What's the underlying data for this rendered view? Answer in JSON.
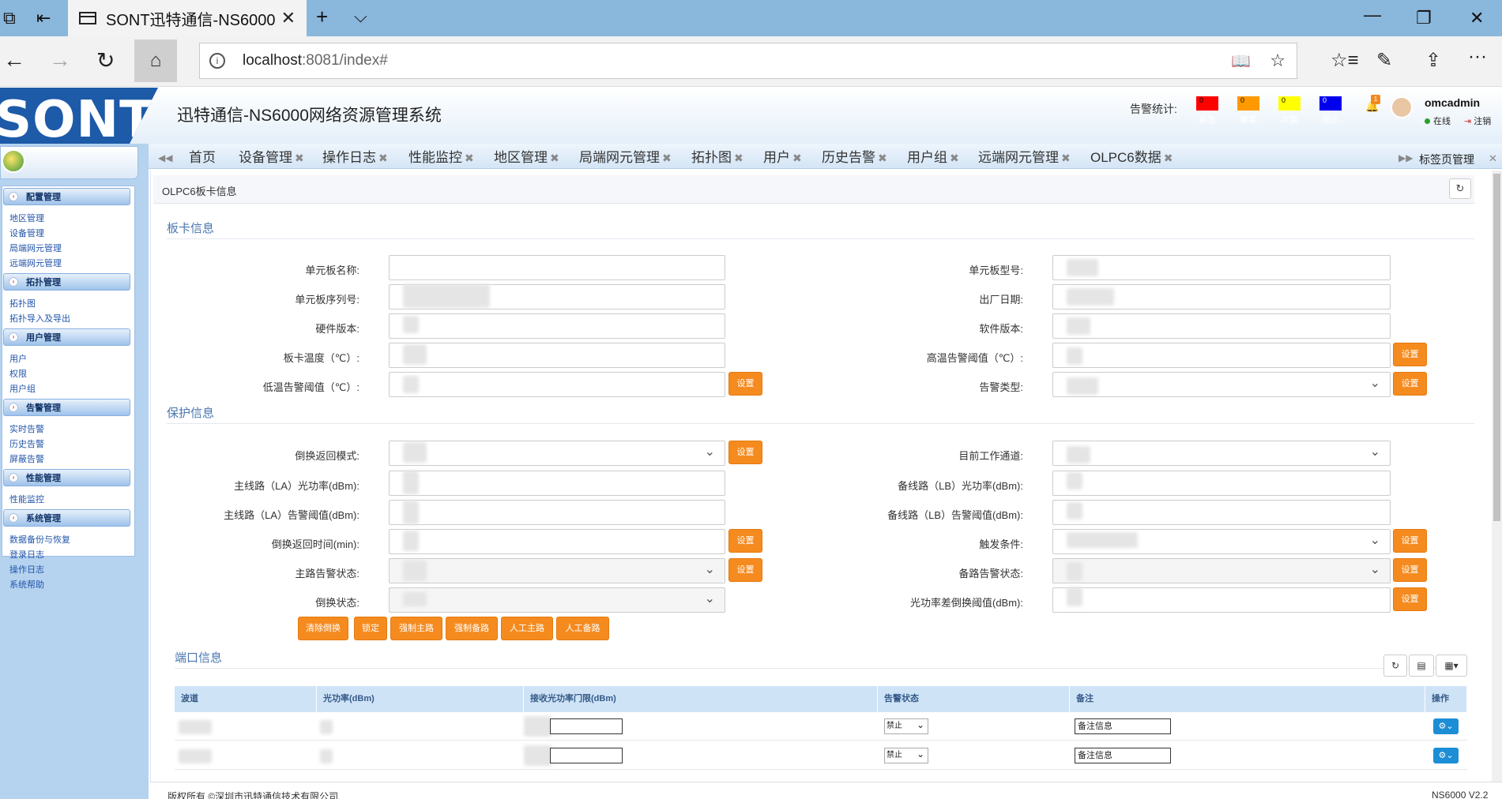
{
  "browser": {
    "tab_title": "SONT迅特通信-NS6000",
    "url_host": "localhost",
    "url_rest": ":8081/index#"
  },
  "app": {
    "logo_text": "SONT",
    "title": "迅特通信-NS6000网络资源管理系统",
    "alarm_stat_label": "告警统计:",
    "alarms": [
      {
        "label": "紧急",
        "count": "0",
        "color": "#ff0000"
      },
      {
        "label": "重要",
        "count": "0",
        "color": "#ff9900"
      },
      {
        "label": "次要",
        "count": "0",
        "color": "#ffff00"
      },
      {
        "label": "提示",
        "count": "0",
        "color": "#0000ee"
      }
    ],
    "notify_count": "1",
    "user": "omcadmin",
    "online": "在线",
    "logout": "注销"
  },
  "sidebar": {
    "groups": [
      {
        "label": "配置管理",
        "items": [
          "地区管理",
          "设备管理",
          "局端网元管理",
          "远端网元管理"
        ]
      },
      {
        "label": "拓扑管理",
        "items": [
          "拓扑图",
          "拓扑导入及导出"
        ]
      },
      {
        "label": "用户管理",
        "items": [
          "用户",
          "权限",
          "用户组"
        ]
      },
      {
        "label": "告警管理",
        "items": [
          "实时告警",
          "历史告警",
          "屏蔽告警"
        ]
      },
      {
        "label": "性能管理",
        "items": [
          "性能监控"
        ]
      },
      {
        "label": "系统管理",
        "items": [
          "数据备份与恢复",
          "登录日志",
          "操作日志",
          "系统帮助"
        ]
      }
    ]
  },
  "tabs": [
    "首页",
    "设备管理",
    "操作日志",
    "性能监控",
    "地区管理",
    "局端网元管理",
    "拓扑图",
    "用户",
    "历史告警",
    "用户组",
    "远端网元管理",
    "OLPC6数据"
  ],
  "tab_manager": "标签页管理",
  "page": {
    "title": "OLPC6板卡信息",
    "board_section": "板卡信息",
    "protect_section": "保护信息",
    "port_section": "端口信息",
    "set_label": "设置",
    "board_fields": {
      "left": [
        "单元板名称:",
        "单元板序列号:",
        "硬件版本:",
        "板卡温度（℃）:",
        "低温告警阈值（℃）:"
      ],
      "right": [
        "单元板型号:",
        "出厂日期:",
        "软件版本:",
        "高温告警阈值（℃）:",
        "告警类型:"
      ]
    },
    "protect_fields": {
      "left": [
        "倒换返回模式:",
        "主线路（LA）光功率(dBm):",
        "主线路（LA）告警阈值(dBm):",
        "倒换返回时间(min):",
        "主路告警状态:",
        "倒换状态:"
      ],
      "right": [
        "目前工作通道:",
        "备线路（LB）光功率(dBm):",
        "备线路（LB）告警阈值(dBm):",
        "触发条件:",
        "备路告警状态:",
        "光功率差倒换阈值(dBm):"
      ]
    },
    "actions": [
      "清除倒换",
      "锁定",
      "强制主路",
      "强制备路",
      "人工主路",
      "人工备路"
    ],
    "port_table": {
      "headers": [
        "波道",
        "光功率(dBm)",
        "接收光功率门限(dBm)",
        "告警状态",
        "备注",
        "操作"
      ],
      "rows": [
        {
          "alarm": "禁止",
          "note": "备注信息"
        },
        {
          "alarm": "禁止",
          "note": "备注信息"
        }
      ]
    },
    "copyright": "版权所有 ©深圳市迅特通信技术有限公司",
    "version": "NS6000 V2.2"
  }
}
